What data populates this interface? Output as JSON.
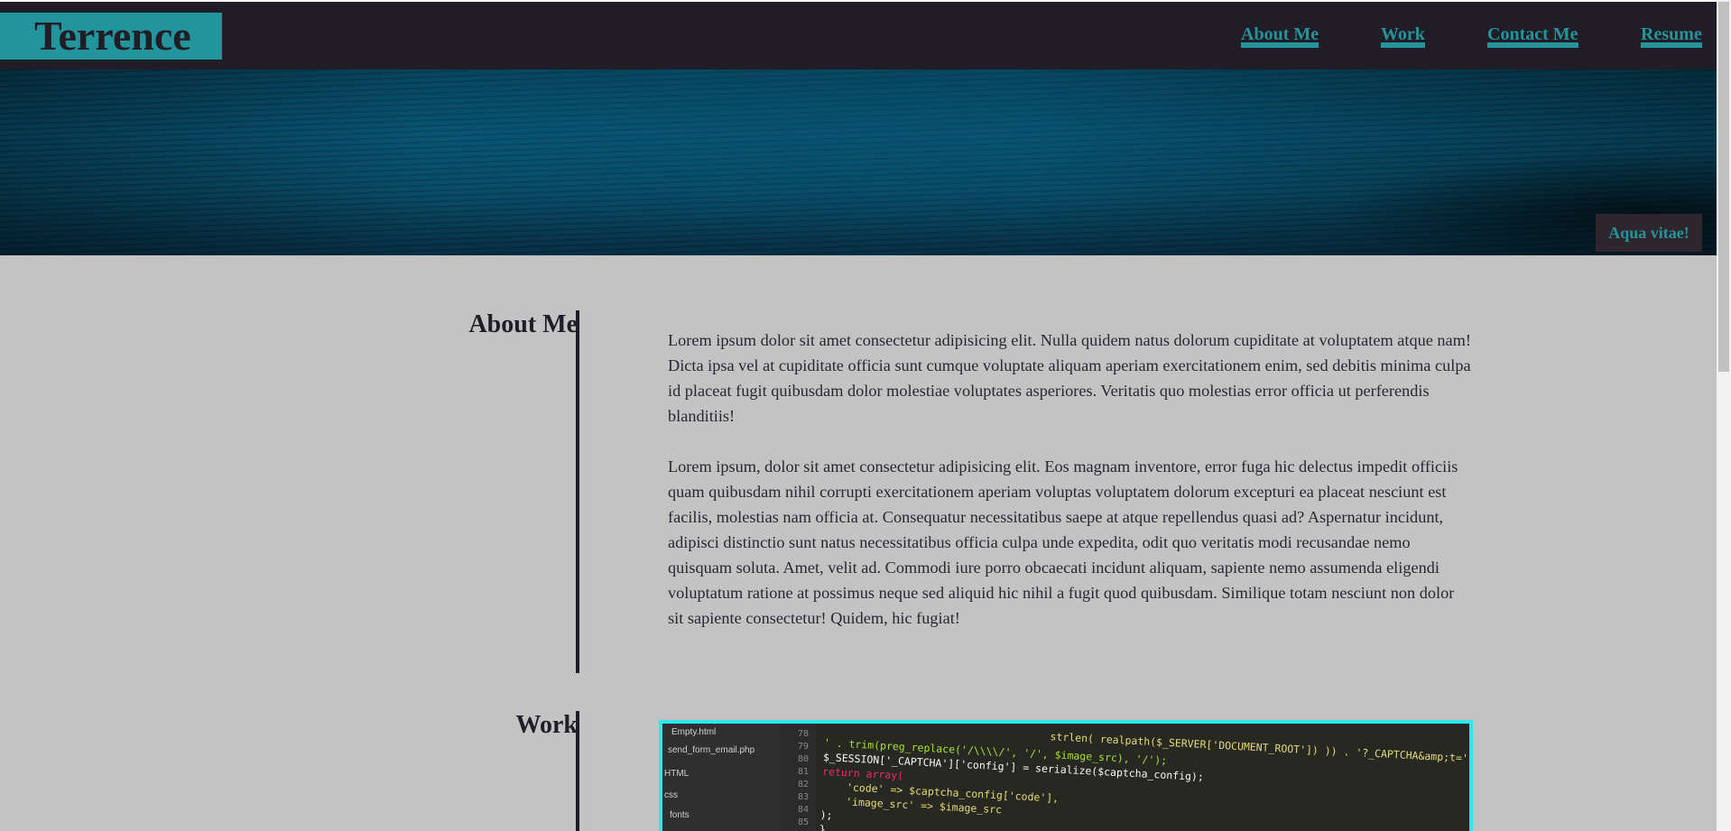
{
  "header": {
    "brand": "Terrence",
    "nav": [
      {
        "label": "About Me"
      },
      {
        "label": "Work"
      },
      {
        "label": "Contact Me"
      },
      {
        "label": "Resume"
      }
    ]
  },
  "hero": {
    "caption": "Aqua vitae!"
  },
  "about": {
    "title": "About Me",
    "paragraphs": [
      "Lorem ipsum dolor sit amet consectetur adipisicing elit. Nulla quidem natus dolorum cupiditate at voluptatem atque nam! Dicta ipsa vel at cupiditate officia sunt cumque voluptate aliquam aperiam exercitationem enim, sed debitis minima culpa id placeat fugit quibusdam dolor molestiae voluptates asperiores. Veritatis quo molestias error officia ut perferendis blanditiis!",
      "Lorem ipsum, dolor sit amet consectetur adipisicing elit. Eos magnam inventore, error fuga hic delectus impedit officiis quam quibusdam nihil corrupti exercitationem aperiam voluptas voluptatem dolorum excepturi ea placeat nesciunt est facilis, molestias nam officia at. Consequatur necessitatibus saepe at atque repellendus quasi ad? Aspernatur incidunt, adipisci distinctio sunt natus necessitatibus officia culpa unde expedita, odit quo veritatis modi recusandae nemo quisquam soluta. Amet, velit ad. Commodi iure porro obcaecati incidunt aliquam, sapiente nemo assumenda eligendi voluptatum ratione at possimus neque sed aliquid hic nihil a fugit quod quibusdam. Similique totam nesciunt non dolor sit sapiente consectetur! Quidem, hic fugiat!"
    ]
  },
  "work": {
    "title": "Work",
    "image": {
      "sidebar_files": [
        "Empty.html",
        "send_form_email.php",
        "HTML",
        "css",
        "fonts"
      ],
      "line_numbers": [
        "78",
        "79",
        "80",
        "81",
        "82",
        "83",
        "84",
        "85"
      ],
      "code_lines": [
        "' . trim(preg_replace('/\\\\\\\\/', '/', $image_src), '/');",
        "$_SESSION['_CAPTCHA']['config'] = serialize($captcha_config);",
        "return array(",
        "    'code' => $captcha_config['code'],",
        "    'image_src' => $image_src",
        ");",
        "}",
        "strlen( realpath($_SERVER['DOCUMENT_ROOT']) )) . '?_CAPTCHA&amp;t=' . ur"
      ]
    }
  },
  "colors": {
    "accent": "#23949b",
    "header_bg": "#211d26",
    "page_bg": "#c3c3c3",
    "image_border": "#2ee6ee"
  }
}
